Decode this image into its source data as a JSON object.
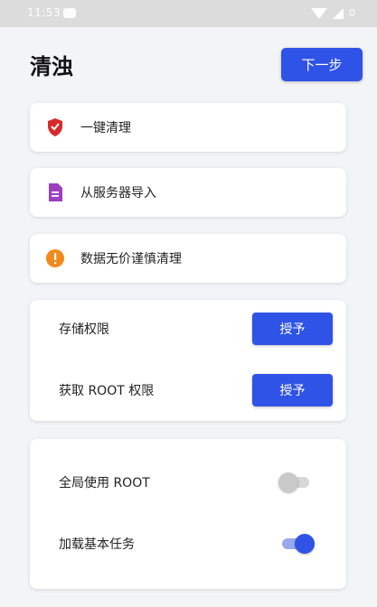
{
  "status_bar": {
    "time": "11:53",
    "battery": "0"
  },
  "header": {
    "title": "清浊",
    "next_label": "下一步"
  },
  "actions": [
    {
      "label": "一键清理",
      "icon": "shield-icon",
      "color": "#d72b2b"
    },
    {
      "label": "从服务器导入",
      "icon": "document-icon",
      "color": "#9b3fbf"
    },
    {
      "label": "数据无价谨慎清理",
      "icon": "warning-icon",
      "color": "#f08a1c"
    }
  ],
  "permissions": {
    "storage_label": "存储权限",
    "storage_button": "授予",
    "root_label": "获取 ROOT 权限",
    "root_button": "授予"
  },
  "settings": {
    "global_root_label": "全局使用 ROOT",
    "global_root_on": false,
    "load_tasks_label": "加载基本任务",
    "load_tasks_on": true
  },
  "colors": {
    "accent": "#2f53e6"
  }
}
